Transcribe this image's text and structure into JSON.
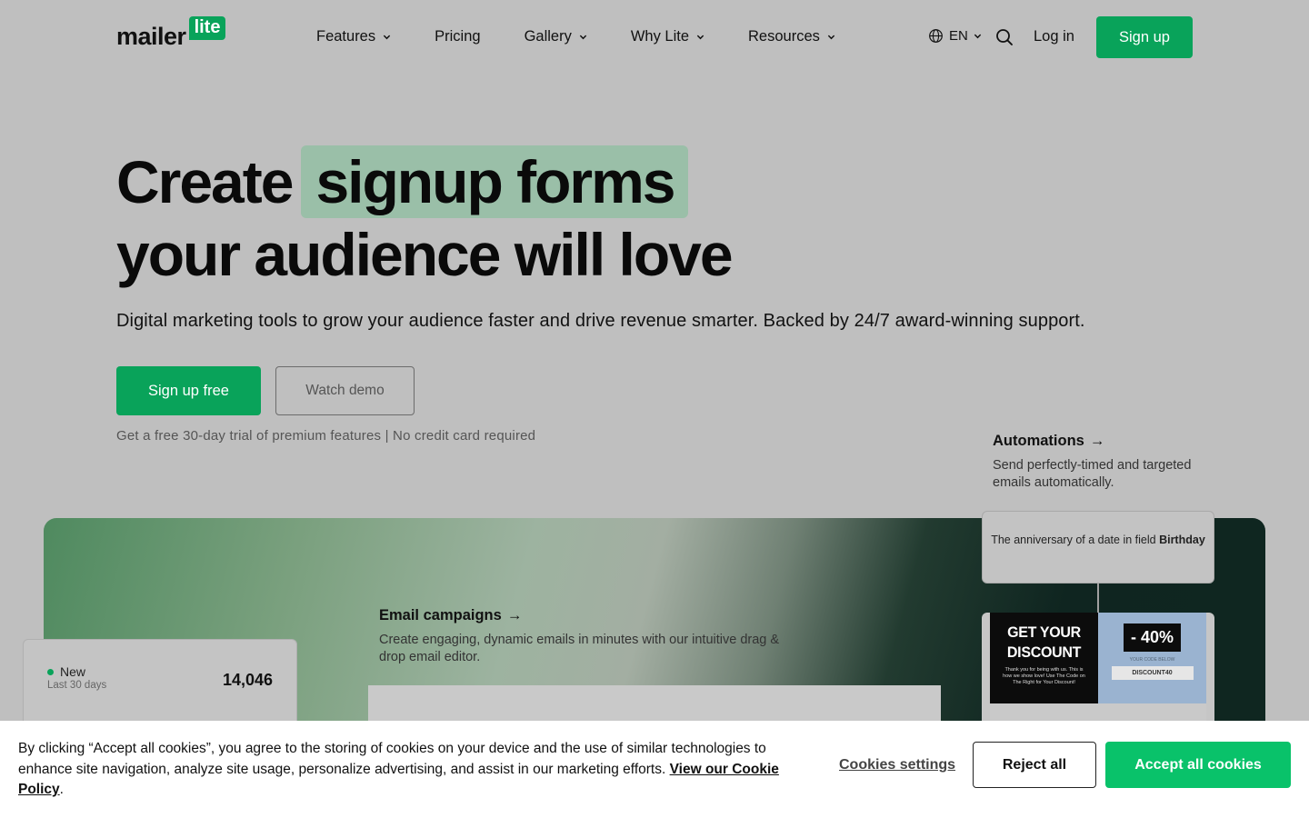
{
  "header": {
    "logo_word": "mailer",
    "logo_badge": "lite",
    "nav": [
      {
        "label": "Features",
        "has_dropdown": true
      },
      {
        "label": "Pricing",
        "has_dropdown": false
      },
      {
        "label": "Gallery",
        "has_dropdown": true
      },
      {
        "label": "Why Lite",
        "has_dropdown": true
      },
      {
        "label": "Resources",
        "has_dropdown": true
      }
    ],
    "language": "EN",
    "login_label": "Log in",
    "signup_label": "Sign up"
  },
  "hero": {
    "title_part1": "Create",
    "title_highlight": "signup forms",
    "title_line2": "your audience will love",
    "subtitle": "Digital marketing tools to grow your audience faster and drive revenue smarter. Backed by 24/7 award-winning support.",
    "primary_cta": "Sign up free",
    "secondary_cta": "Watch demo",
    "trial_note": "Get a free 30-day trial of premium features | No credit card required"
  },
  "features": {
    "automations": {
      "title": "Automations",
      "description": "Send perfectly-timed and targeted emails automatically.",
      "trigger_text": "The anniversary of a date in field",
      "trigger_field": "Birthday",
      "promo_headline": "GET YOUR DISCOUNT",
      "promo_small": "Thank you for being with us. This is how we show love! Use The Code on The Right for Your Discount!",
      "promo_percent": "- 40%",
      "promo_code_label": "YOUR CODE BELOW",
      "promo_code": "DISCOUNT40"
    },
    "email_campaigns": {
      "title": "Email campaigns",
      "description": "Create engaging, dynamic emails in minutes with our intuitive drag & drop email editor."
    },
    "stats": {
      "label": "New",
      "period": "Last 30 days",
      "value": "14,046"
    }
  },
  "cookie": {
    "text": "By clicking “Accept all cookies”, you agree to the storing of cookies on your device and the use of similar technologies to enhance site navigation, analyze site usage, personalize advertising, and assist in our marketing efforts.",
    "policy_link": "View our Cookie Policy",
    "settings_label": "Cookies settings",
    "reject_label": "Reject all",
    "accept_label": "Accept all cookies"
  },
  "colors": {
    "brand_green": "#09a35a",
    "accept_green": "#09c26a",
    "highlight": "#9abfa8"
  }
}
